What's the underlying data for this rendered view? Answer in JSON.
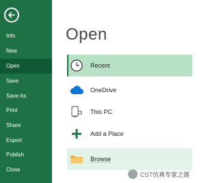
{
  "sidebar": {
    "items": [
      {
        "label": "Info"
      },
      {
        "label": "New"
      },
      {
        "label": "Open"
      },
      {
        "label": "Save"
      },
      {
        "label": "Save As"
      },
      {
        "label": "Print"
      },
      {
        "label": "Share"
      },
      {
        "label": "Export"
      },
      {
        "label": "Publish"
      },
      {
        "label": "Close"
      }
    ]
  },
  "main": {
    "title": "Open",
    "locations": [
      {
        "label": "Recent"
      },
      {
        "label": "OneDrive"
      },
      {
        "label": "This PC"
      },
      {
        "label": "Add a Place"
      },
      {
        "label": "Browse"
      }
    ]
  },
  "watermark": {
    "text": "CST仿真专家之路"
  },
  "colors": {
    "sidebar_bg": "#1e7145",
    "selected_nav": "#0f5a34",
    "selected_row": "#b7e0c5",
    "browse_row": "#e2f3e7"
  }
}
